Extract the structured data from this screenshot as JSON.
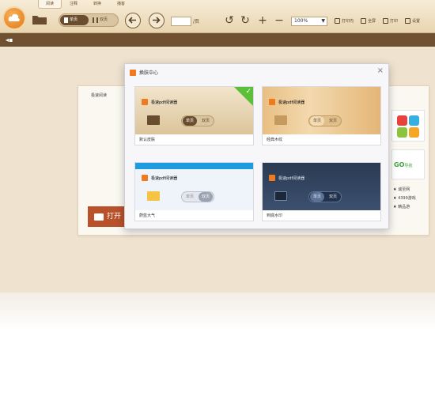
{
  "app": {
    "menu_tabs": [
      "阅读",
      "注释",
      "转换",
      "播客"
    ],
    "view_toggle": {
      "single_label": "单页",
      "double_label": "双页"
    },
    "page_suffix": "/页",
    "zoom_value": "100%",
    "tools": [
      "打印内",
      "全屏",
      "打印",
      "设置"
    ]
  },
  "startpage": {
    "header": "极速阅读",
    "open_button": "打开",
    "ad2_text": "GO",
    "ad2_text_small": "导航",
    "links": [
      "♦ 诚至网",
      "♦ 4399游戏",
      "♦ 精品游"
    ]
  },
  "dialog": {
    "title": "换肤中心",
    "close": "×",
    "skins": [
      {
        "label": "默认皮肤",
        "app_name": "极速pdf阅读器",
        "single": "单页",
        "double": "双页",
        "selected": true
      },
      {
        "label": "经典木纹",
        "app_name": "极速pdf阅读器",
        "single": "单页",
        "double": "双页",
        "selected": false
      },
      {
        "label": "蔚蓝大气",
        "app_name": "极速pdf阅读器",
        "single": "单页",
        "double": "双页",
        "selected": false
      },
      {
        "label": "到底水印",
        "app_name": "极速pdf阅读器",
        "single": "单页",
        "double": "双页",
        "selected": false
      }
    ]
  },
  "colors": {
    "toolbar": "#e8d5b0",
    "subbar": "#6f5031",
    "accent": "#f07a20",
    "open_button": "#b9512a",
    "selected_check": "#5bbf3a"
  }
}
